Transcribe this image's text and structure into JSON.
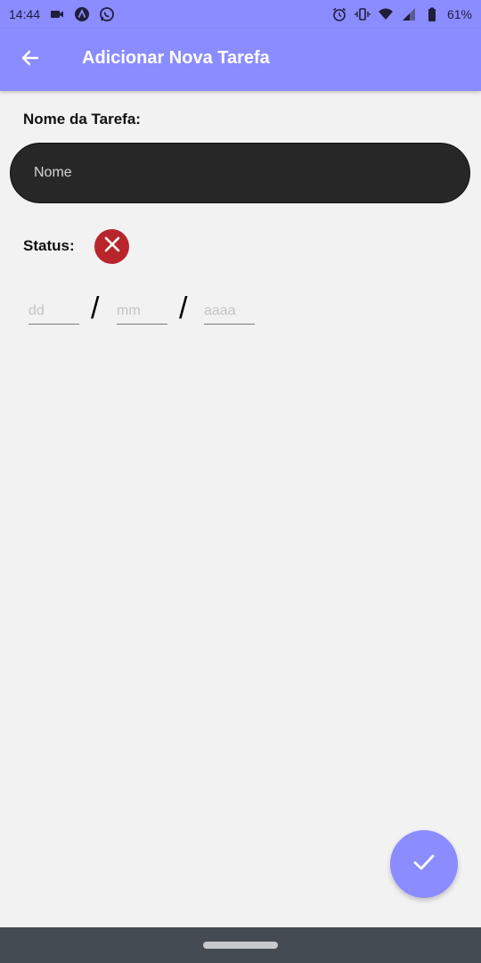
{
  "status_bar": {
    "time": "14:44",
    "battery": "61%",
    "icons_left": [
      "video-icon",
      "app-a-icon",
      "whatsapp-icon"
    ],
    "icons_right": [
      "alarm-icon",
      "vibrate-icon",
      "wifi-icon",
      "signal-icon",
      "battery-icon"
    ]
  },
  "app_bar": {
    "title": "Adicionar Nova Tarefa",
    "back_icon": "arrow-left-icon",
    "color": "#8a8cff"
  },
  "form": {
    "name_label": "Nome da Tarefa:",
    "name_placeholder": "Nome",
    "name_value": "",
    "status_label": "Status:",
    "status_icon": "close-icon",
    "status_color": "#b8252a",
    "date": {
      "day_placeholder": "dd",
      "month_placeholder": "mm",
      "year_placeholder": "aaaa",
      "separator": "/"
    }
  },
  "fab": {
    "icon": "check-icon"
  }
}
